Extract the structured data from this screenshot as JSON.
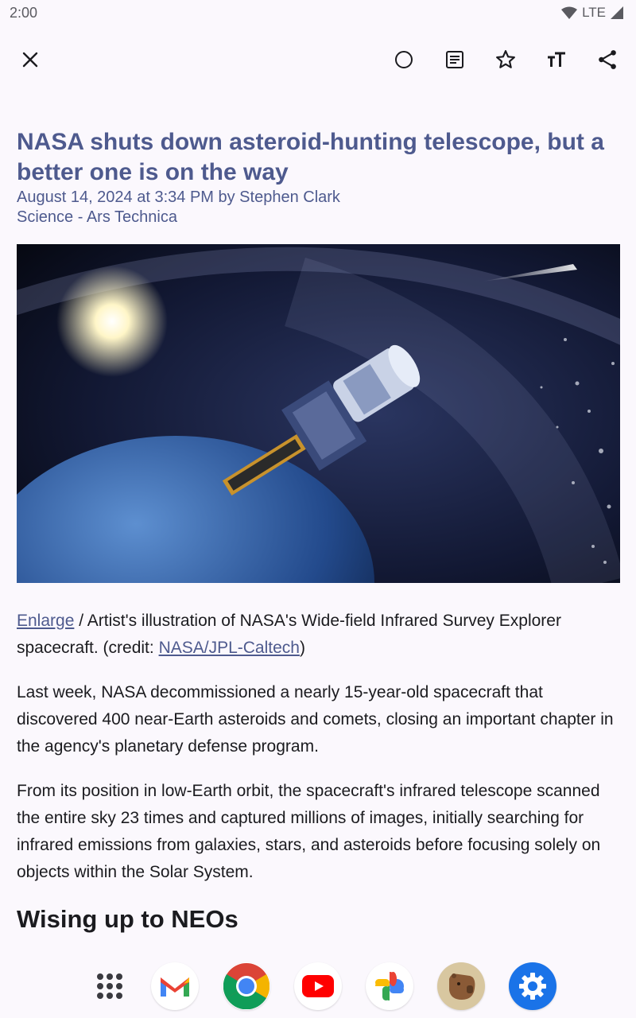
{
  "status": {
    "time": "2:00",
    "network": "LTE"
  },
  "toolbar": {
    "close_icon": "close-icon",
    "actions": [
      "circle-icon",
      "reader-icon",
      "star-icon",
      "text-size-icon",
      "share-icon"
    ]
  },
  "article": {
    "title": "NASA shuts down asteroid-hunting telescope, but a better one is on the way",
    "byline": "August 14, 2024 at 3:34 PM by Stephen Clark",
    "source": "Science - Ars Technica",
    "caption": {
      "enlarge": "Enlarge",
      "text": " / Artist's illustration of NASA's Wide-field Infrared Survey Explorer spacecraft. (credit: ",
      "credit_link": "NASA/JPL-Caltech",
      "close": ")"
    },
    "paragraphs": [
      "Last week, NASA decommissioned a nearly 15-year-old spacecraft that discovered 400 near-Earth asteroids and comets, closing an important chapter in the agency's planetary defense program.",
      "From its position in low-Earth orbit, the spacecraft's infrared telescope scanned the entire sky 23 times and captured millions of images, initially searching for infrared emissions from galaxies, stars, and asteroids before focusing solely on objects within the Solar System."
    ],
    "subheading": "Wising up to NEOs"
  },
  "dock": {
    "apps": [
      "app-drawer-icon",
      "gmail-icon",
      "chrome-icon",
      "youtube-icon",
      "photos-icon",
      "capybara-app-icon",
      "settings-icon"
    ]
  },
  "colors": {
    "accent": "#4e5a8e",
    "background": "#fbf8fd",
    "text": "#1b1b1f"
  }
}
